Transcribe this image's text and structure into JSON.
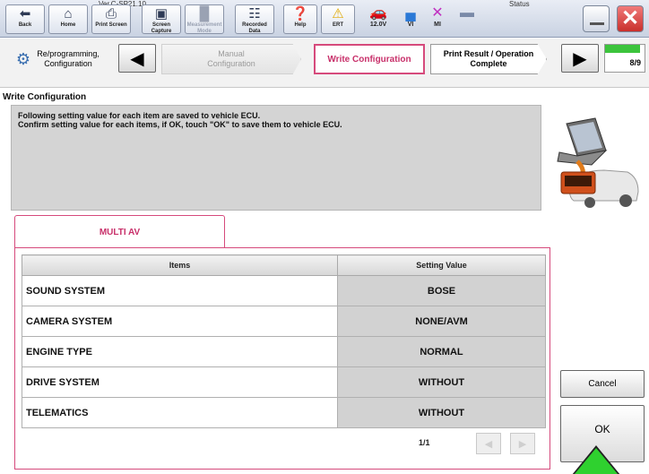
{
  "app": {
    "version_label": "Ver.C-SP21.10",
    "status_label": "Status"
  },
  "toolbar": {
    "buttons": [
      {
        "label": "Back"
      },
      {
        "label": "Home"
      },
      {
        "label": "Print Screen"
      },
      {
        "label": "Screen Capture"
      },
      {
        "label": "Measurement Mode"
      },
      {
        "label": "Recorded Data"
      },
      {
        "label": "Help"
      },
      {
        "label": "ERT"
      }
    ],
    "status": {
      "voltage": "12.0V",
      "vi": "VI",
      "mi": "MI"
    }
  },
  "steps": {
    "reprogramming": "Re/programming, Configuration",
    "manual": "Manual Configuration",
    "write": "Write Configuration",
    "print": "Print Result / Operation Complete",
    "progress": "8/9",
    "progress_fraction": 0.889
  },
  "section_title": "Write Configuration",
  "message": {
    "line1": "Following setting value for each item are saved to vehicle ECU.",
    "line2": "Confirm setting value for each items, if OK, touch \"OK\" to save them to vehicle ECU."
  },
  "tab_label": "MULTI AV",
  "table": {
    "headers": {
      "items": "Items",
      "value": "Setting Value"
    },
    "rows": [
      {
        "item": "SOUND SYSTEM",
        "value": "BOSE"
      },
      {
        "item": "CAMERA SYSTEM",
        "value": "NONE/AVM"
      },
      {
        "item": "ENGINE TYPE",
        "value": "NORMAL"
      },
      {
        "item": "DRIVE SYSTEM",
        "value": "WITHOUT"
      },
      {
        "item": "TELEMATICS",
        "value": "WITHOUT"
      }
    ],
    "page": "1/1"
  },
  "actions": {
    "cancel": "Cancel",
    "ok": "OK"
  },
  "colors": {
    "accent": "#d64a7c",
    "progress": "#3cc43c",
    "arrow": "#2fd12f"
  }
}
